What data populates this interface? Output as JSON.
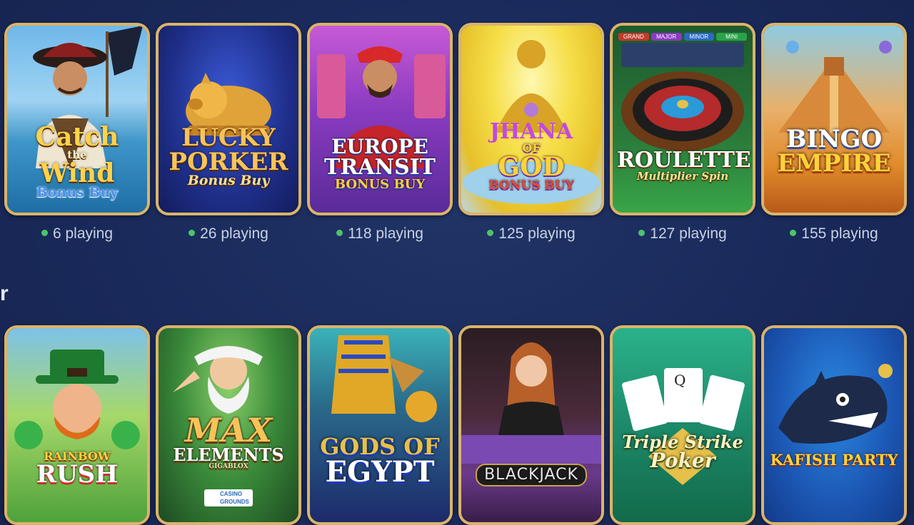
{
  "section_heading_fragment": "r",
  "row1": [
    {
      "title1": "Catch",
      "title2": "the",
      "title3": "Wind",
      "subtitle": "Bonus Buy",
      "playing": "6 playing"
    },
    {
      "title1": "LUCKY",
      "title2": "PORKER",
      "title3": "",
      "subtitle": "Bonus Buy",
      "playing": "26 playing"
    },
    {
      "title1": "EUROPE",
      "title2": "TRANSIT",
      "title3": "",
      "subtitle": "BONUS BUY",
      "playing": "118 playing"
    },
    {
      "title1": "JHANA",
      "title2": "OF",
      "title3": "GOD",
      "subtitle": "BONUS BUY",
      "playing": "125 playing"
    },
    {
      "title1": "ROULETTE",
      "title2": "",
      "title3": "",
      "subtitle": "Multiplier Spin",
      "playing": "127 playing",
      "jackpots": [
        "GRAND",
        "MAJOR",
        "MINOR",
        "MINI"
      ]
    },
    {
      "title1": "BINGO",
      "title2": "EMPIRE",
      "title3": "",
      "subtitle": "",
      "playing": "155 playing"
    }
  ],
  "row2": [
    {
      "title1": "RAINBOW",
      "title2": "RUSH",
      "title3": ""
    },
    {
      "title1": "MAX",
      "title2": "ELEMENTS",
      "title3": "GIGABLOX",
      "badge": "CASINO GROUNDS"
    },
    {
      "title1": "GODS OF",
      "title2": "EGYPT",
      "title3": ""
    },
    {
      "title1": "BLACKJACK",
      "title2": "",
      "title3": ""
    },
    {
      "title1": "Triple Strike",
      "title2": "Poker",
      "title3": ""
    },
    {
      "title1": "KAFISH PARTY",
      "title2": "",
      "title3": ""
    }
  ]
}
